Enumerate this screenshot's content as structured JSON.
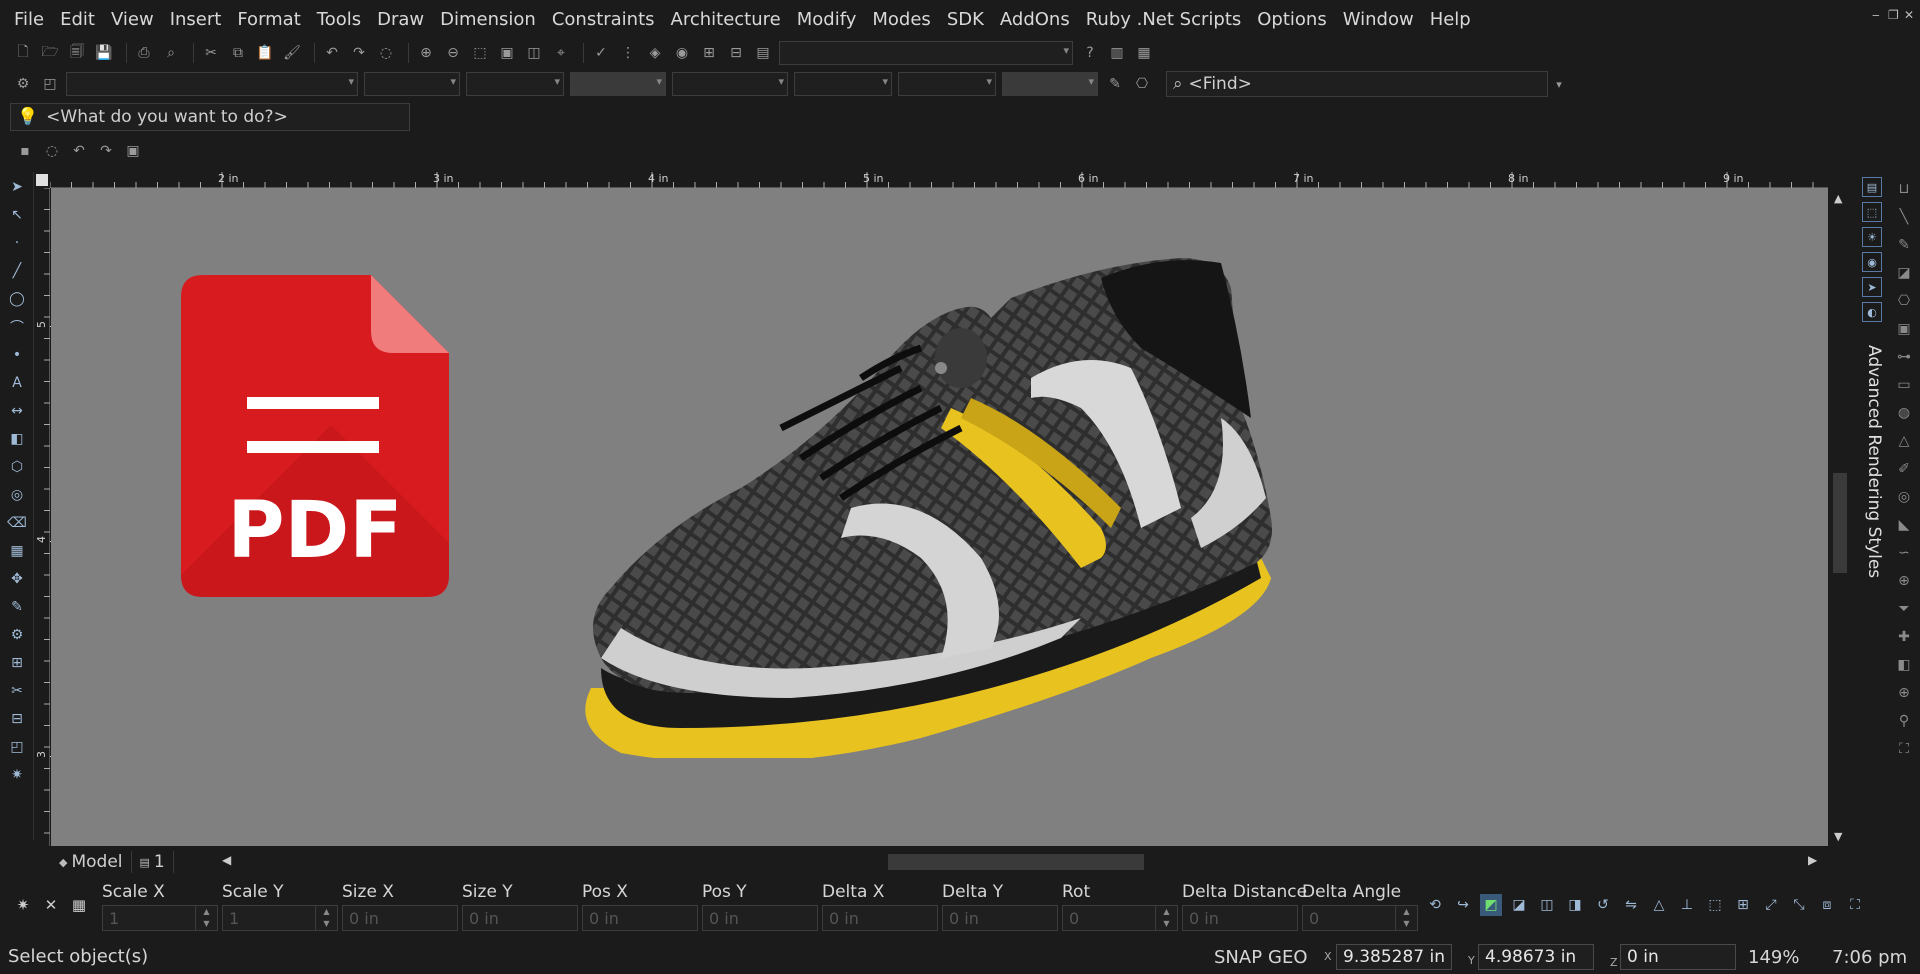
{
  "menu": [
    "File",
    "Edit",
    "View",
    "Insert",
    "Format",
    "Tools",
    "Draw",
    "Dimension",
    "Constraints",
    "Architecture",
    "Modify",
    "Modes",
    "SDK",
    "AddOns",
    "Ruby .Net Scripts",
    "Options",
    "Window",
    "Help"
  ],
  "search": {
    "find_placeholder": "<Find>",
    "what_placeholder": "<What do you want to do?>"
  },
  "ruler": {
    "h_labels": [
      "2 in",
      "3 in",
      "4 in",
      "5 in",
      "6 in",
      "7 in",
      "8 in",
      "9 in"
    ],
    "v_labels": [
      "5 in",
      "4 in",
      "3 in"
    ]
  },
  "canvas": {
    "pdf_label": "PDF"
  },
  "docks": {
    "panel_label": "Advanced Rendering Styles"
  },
  "tabs": [
    {
      "label": "Model"
    },
    {
      "label": "1"
    }
  ],
  "transform_fields": [
    {
      "label": "Scale X",
      "value": "1",
      "spinner": true
    },
    {
      "label": "Scale Y",
      "value": "1",
      "spinner": true
    },
    {
      "label": "Size X",
      "value": "0 in",
      "spinner": false
    },
    {
      "label": "Size Y",
      "value": "0 in",
      "spinner": false
    },
    {
      "label": "Pos X",
      "value": "0 in",
      "spinner": false
    },
    {
      "label": "Pos Y",
      "value": "0 in",
      "spinner": false
    },
    {
      "label": "Delta X",
      "value": "0 in",
      "spinner": false
    },
    {
      "label": "Delta Y",
      "value": "0 in",
      "spinner": false
    },
    {
      "label": "Rot",
      "value": "0",
      "spinner": true
    },
    {
      "label": "Delta Distance",
      "value": "0 in",
      "spinner": false
    },
    {
      "label": "Delta Angle",
      "value": "0",
      "spinner": true
    }
  ],
  "status": {
    "message": "Select object(s)",
    "snap": "SNAP",
    "geo": "GEO",
    "x_label": "X",
    "x_value": "9.385287 in",
    "y_label": "Y",
    "y_value": "4.98673 in",
    "z_label": "Z",
    "z_value": "0 in",
    "zoom": "149%",
    "time": "7:06 pm"
  },
  "colors": {
    "background": "#1b1b1b",
    "canvas": "#808080",
    "pdf_red": "#d81b1f",
    "shoe_yellow": "#e8c21f"
  }
}
